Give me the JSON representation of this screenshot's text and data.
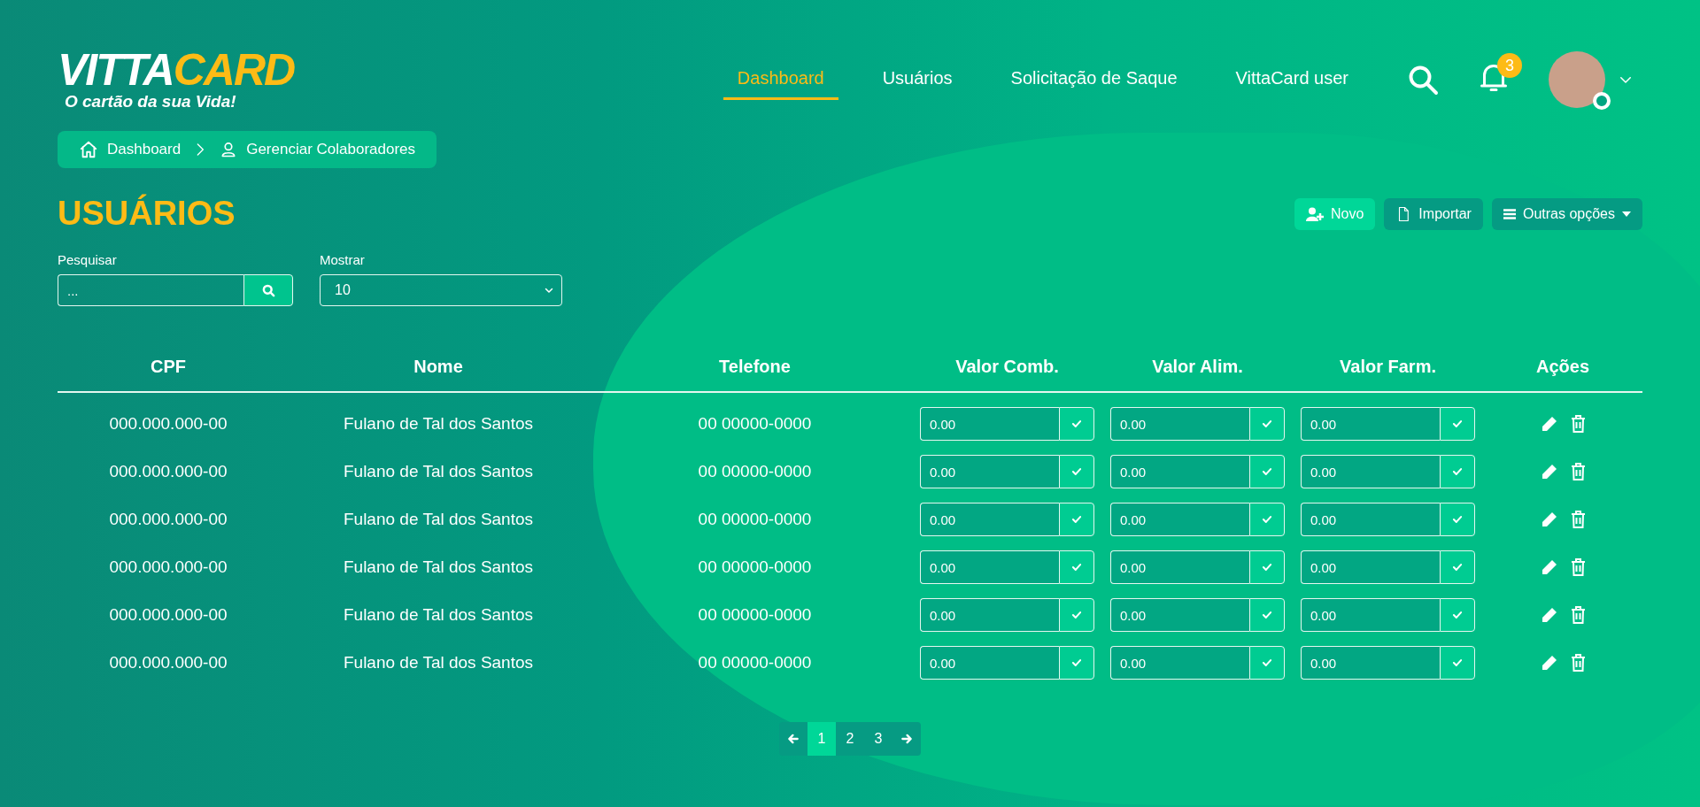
{
  "logo": {
    "word_1": "VITTA",
    "word_2": "CARD",
    "tagline": "O cartão da sua Vida!"
  },
  "nav": [
    {
      "label": "Dashboard",
      "selected": true
    },
    {
      "label": "Usuários",
      "selected": false
    },
    {
      "label": "Solicitação de Saque",
      "selected": false
    },
    {
      "label": "VittaCard user",
      "selected": false
    }
  ],
  "notifications": {
    "count": "3"
  },
  "breadcrumb": [
    {
      "label": "Dashboard",
      "kind": "home"
    },
    {
      "label": "Gerenciar Colaboradores",
      "kind": "user"
    }
  ],
  "title": "USUÁRIOS",
  "actions": [
    {
      "label": "Novo",
      "kind": "add-user"
    },
    {
      "label": "Importar",
      "kind": "file"
    },
    {
      "label": "Outras opções",
      "kind": "menu"
    }
  ],
  "search": {
    "label": "Pesquisar",
    "placeholder": "..."
  },
  "show": {
    "label": "Mostrar",
    "value": "10"
  },
  "table": {
    "columns": [
      "CPF",
      "Nome",
      "Telefone",
      "Valor Comb.",
      "Valor Alim.",
      "Valor Farm.",
      "Ações"
    ],
    "rows": [
      {
        "cpf": "000.000.000-00",
        "nome": "Fulano de Tal dos Santos",
        "telefone": "00 00000-0000",
        "valores": [
          "0.00",
          "0.00",
          "0.00"
        ]
      },
      {
        "cpf": "000.000.000-00",
        "nome": "Fulano de Tal dos Santos",
        "telefone": "00 00000-0000",
        "valores": [
          "0.00",
          "0.00",
          "0.00"
        ]
      },
      {
        "cpf": "000.000.000-00",
        "nome": "Fulano de Tal dos Santos",
        "telefone": "00 00000-0000",
        "valores": [
          "0.00",
          "0.00",
          "0.00"
        ]
      },
      {
        "cpf": "000.000.000-00",
        "nome": "Fulano de Tal dos Santos",
        "telefone": "00 00000-0000",
        "valores": [
          "0.00",
          "0.00",
          "0.00"
        ]
      },
      {
        "cpf": "000.000.000-00",
        "nome": "Fulano de Tal dos Santos",
        "telefone": "00 00000-0000",
        "valores": [
          "0.00",
          "0.00",
          "0.00"
        ]
      },
      {
        "cpf": "000.000.000-00",
        "nome": "Fulano de Tal dos Santos",
        "telefone": "00 00000-0000",
        "valores": [
          "0.00",
          "0.00",
          "0.00"
        ]
      }
    ]
  },
  "pagination": [
    {
      "label": "1",
      "selected": true
    },
    {
      "label": "2",
      "selected": false
    },
    {
      "label": "3",
      "selected": false
    }
  ]
}
